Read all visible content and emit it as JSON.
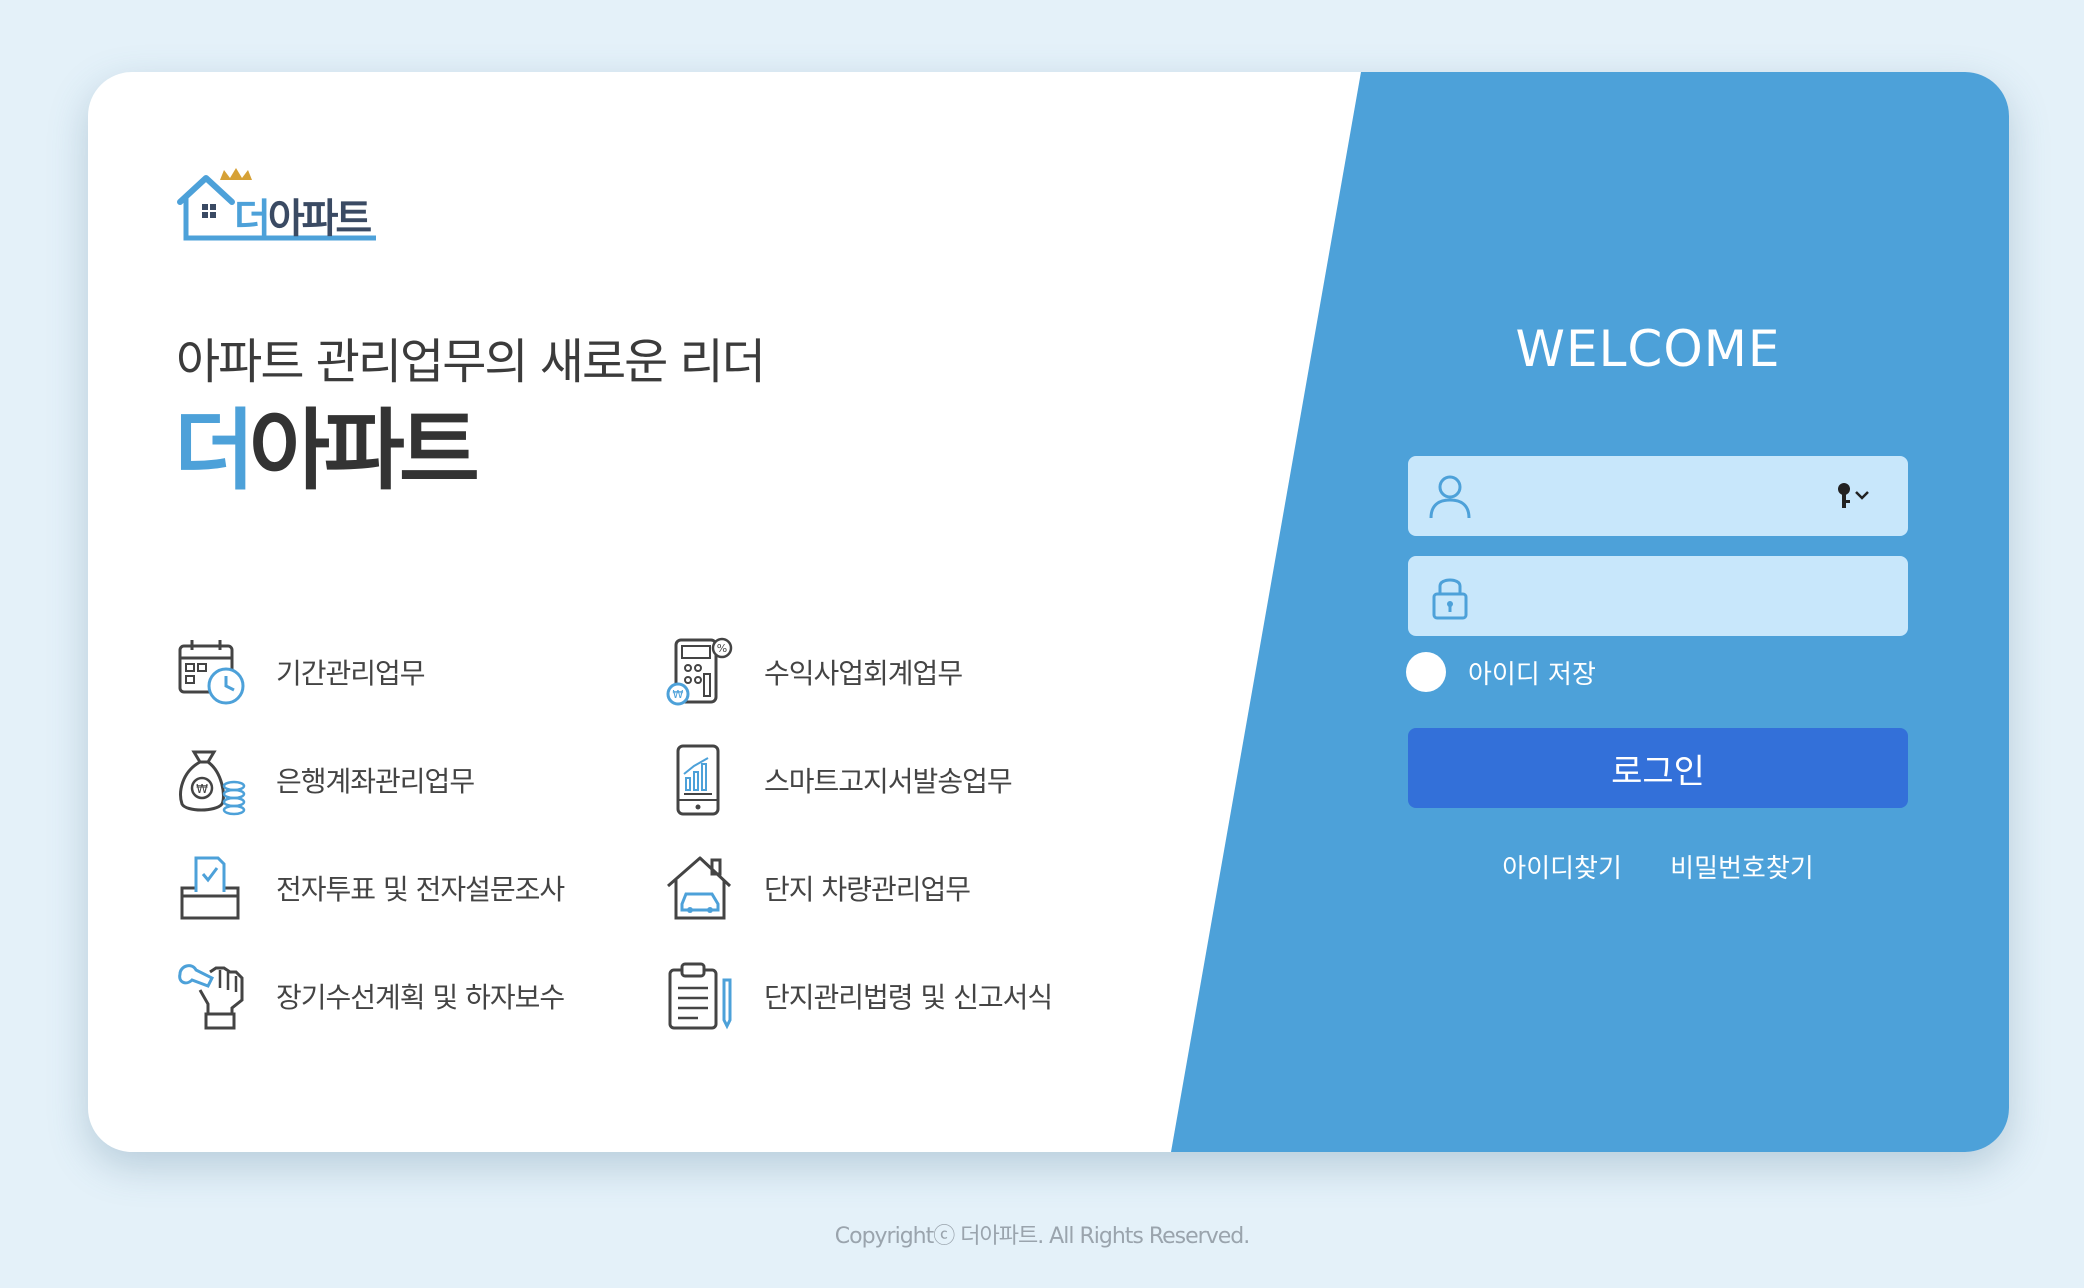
{
  "logo": {
    "first_char": "더",
    "rest": "아파트"
  },
  "tagline": "아파트 관리업무의 새로운 리더",
  "brand": {
    "first_char": "더",
    "rest": "아파트"
  },
  "features": [
    {
      "label": "기간관리업무",
      "icon": "calendar-clock-icon"
    },
    {
      "label": "수익사업회계업무",
      "icon": "calculator-icon"
    },
    {
      "label": "은행계좌관리업무",
      "icon": "money-bag-icon"
    },
    {
      "label": "스마트고지서발송업무",
      "icon": "smartphone-chart-icon"
    },
    {
      "label": "전자투표 및 전자설문조사",
      "icon": "ballot-box-icon"
    },
    {
      "label": "단지 차량관리업무",
      "icon": "house-car-icon"
    },
    {
      "label": "장기수선계획 및 하자보수",
      "icon": "wrench-hand-icon"
    },
    {
      "label": "단지관리법령 및 신고서식",
      "icon": "clipboard-document-icon"
    }
  ],
  "login": {
    "welcome": "WELCOME",
    "id_placeholder": "",
    "password_placeholder": "",
    "remember_label": "아이디 저장",
    "login_button": "로그인",
    "find_id": "아이디찾기",
    "find_password": "비밀번호찾기"
  },
  "copyright": "Copyrightⓒ 더아파트. All Rights Reserved.",
  "colors": {
    "accent": "#4da1d9",
    "button": "#3370d9",
    "field": "#c8e7fb"
  }
}
